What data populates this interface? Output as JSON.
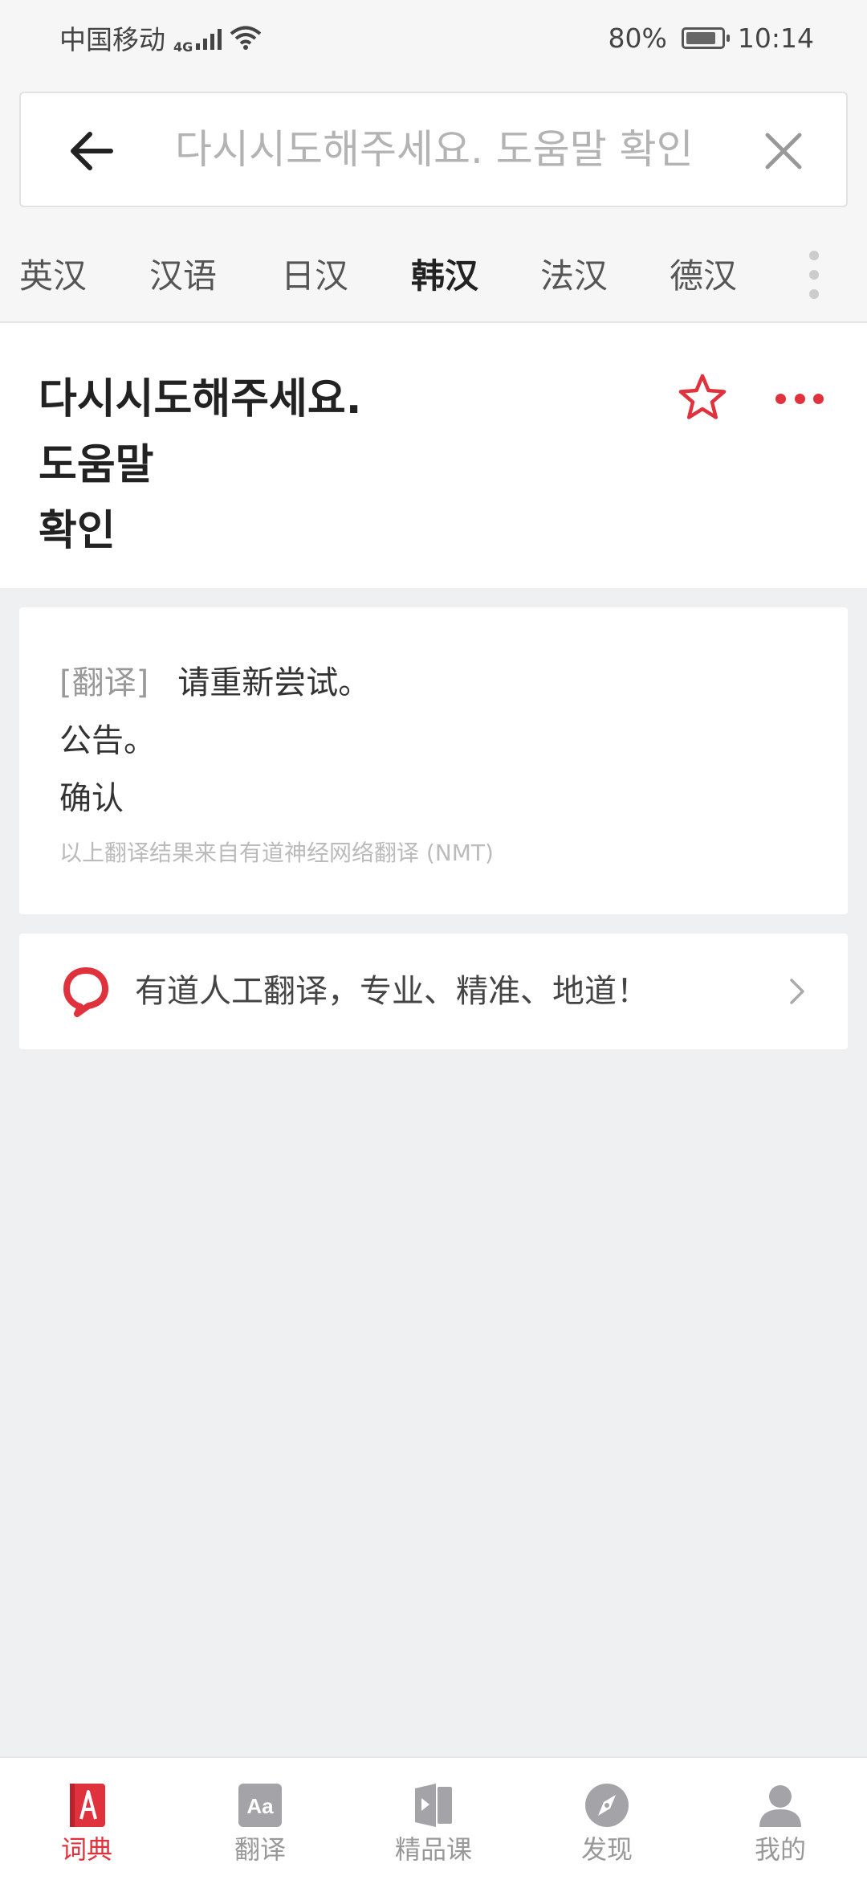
{
  "status_bar": {
    "carrier": "中国移动",
    "network": "4G",
    "battery": "80%",
    "time": "10:14"
  },
  "search": {
    "query": "다시시도해주세요. 도움말 확인",
    "back_icon": "arrow-left-icon",
    "clear_icon": "close-icon"
  },
  "tabs": [
    {
      "label": "英汉",
      "active": false
    },
    {
      "label": "汉语",
      "active": false
    },
    {
      "label": "日汉",
      "active": false
    },
    {
      "label": "韩汉",
      "active": true
    },
    {
      "label": "法汉",
      "active": false
    },
    {
      "label": "德汉",
      "active": false
    }
  ],
  "word": {
    "lines": [
      "다시시도해주세요.",
      "도움말",
      "확인"
    ],
    "favorite_icon": "star-outline-icon",
    "more_icon": "more-dots-icon",
    "accent_color": "#e0323d"
  },
  "translation": {
    "tag": "[翻译]",
    "lines": [
      "请重新尝试。",
      "公告。",
      "确认"
    ],
    "source_note": "以上翻译结果来自有道神经网络翻译 (NMT)"
  },
  "human_translation": {
    "label": "有道人工翻译，专业、精准、地道！",
    "logo_icon": "youdao-human-icon",
    "chevron_icon": "chevron-right-icon"
  },
  "bottom_nav": [
    {
      "label": "词典",
      "icon": "dictionary-icon",
      "active": true
    },
    {
      "label": "翻译",
      "icon": "translate-icon",
      "active": false
    },
    {
      "label": "精品课",
      "icon": "course-icon",
      "active": false
    },
    {
      "label": "发现",
      "icon": "compass-icon",
      "active": false
    },
    {
      "label": "我的",
      "icon": "profile-icon",
      "active": false
    }
  ]
}
